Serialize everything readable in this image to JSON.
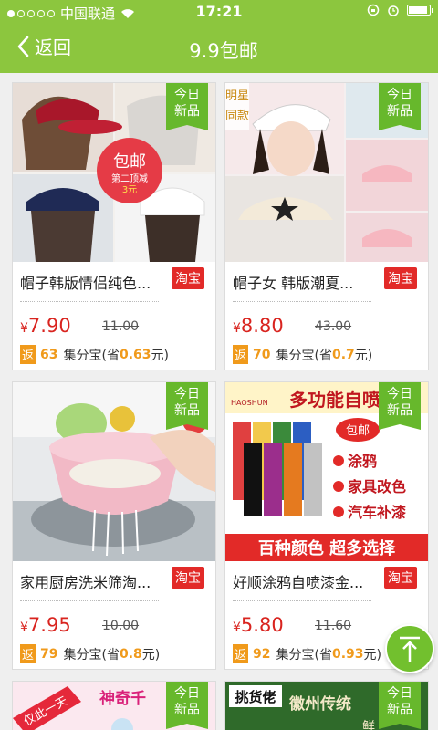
{
  "statusbar": {
    "carrier": "中国联通",
    "time": "17:21"
  },
  "nav": {
    "back_label": "返回",
    "title": "9.9包邮"
  },
  "badge_text": [
    "今日",
    "新品"
  ],
  "products": [
    {
      "name": "帽子韩版情侣纯色...",
      "platform": "淘宝",
      "currency": "¥",
      "price": "7.90",
      "original_price": "11.00",
      "rebate_label": "返",
      "rebate_points": "63",
      "rebate_unit": "集分宝(省",
      "saving": "0.63",
      "saving_unit": "元)",
      "image_text": {
        "line1": "包邮",
        "line2": "第二顶减",
        "line3": "3元"
      }
    },
    {
      "name": "帽子女 韩版潮夏...",
      "platform": "淘宝",
      "currency": "¥",
      "price": "8.80",
      "original_price": "43.00",
      "rebate_label": "返",
      "rebate_points": "70",
      "rebate_unit": "集分宝(省",
      "saving": "0.7",
      "saving_unit": "元)",
      "image_text": {
        "line1": "明星",
        "line2": "同款"
      }
    },
    {
      "name": "家用厨房洗米筛淘...",
      "platform": "淘宝",
      "currency": "¥",
      "price": "7.95",
      "original_price": "10.00",
      "rebate_label": "返",
      "rebate_points": "79",
      "rebate_unit": "集分宝(省",
      "saving": "0.8",
      "saving_unit": "元)"
    },
    {
      "name": "好顺涂鸦自喷漆金...",
      "platform": "淘宝",
      "currency": "¥",
      "price": "5.80",
      "original_price": "11.60",
      "rebate_label": "返",
      "rebate_points": "92",
      "rebate_unit": "集分宝(省",
      "saving": "0.93",
      "saving_unit": "元)",
      "image_text": {
        "brand": "HAOSHUN",
        "headline": "多功能自喷漆",
        "tag": "包邮",
        "bullets": [
          "涂鸦",
          "家具改色",
          "汽车补漆"
        ],
        "footer": "百种颜色 超多选择"
      }
    },
    {
      "image_text": {
        "line1": "仅此一天",
        "line2": "神奇千"
      }
    },
    {
      "image_text": {
        "line1": "挑货佬",
        "line2": "徽州传统",
        "line3": "鲜",
        "line4": "今日"
      }
    }
  ],
  "colors": {
    "header": "#8cc63e",
    "badge": "#67b82c",
    "price": "#d9241f",
    "taobao": "#e22a28",
    "rebate": "#f09a1b"
  }
}
